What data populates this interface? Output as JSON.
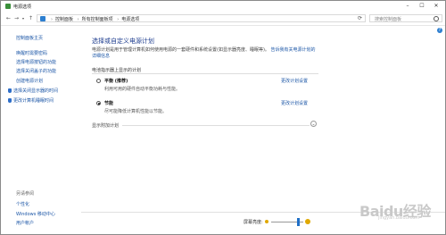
{
  "window": {
    "title": "电源选项"
  },
  "address": {
    "crumbs": [
      "控制面板",
      "所有控制面板项",
      "电源选项"
    ],
    "search_placeholder": "搜索控制面板"
  },
  "leftnav": {
    "home": "控制面板主页",
    "items": [
      "唤醒时需要密码",
      "选择电源按钮的功能",
      "选择关闭盖子的功能",
      "创建电源计划",
      "选择关闭显示器的时间",
      "更改计算机睡眠时间"
    ],
    "see_also_title": "另请参阅",
    "see_also": [
      "个性化",
      "Windows 移动中心",
      "用户帐户"
    ]
  },
  "main": {
    "heading": "选择或自定义电源计划",
    "description": "电源计划是用于管理计算机如何使用电源的一套硬件和系统设置(如显示器亮度、睡眠等)。",
    "learn_more": "告诉我有关电源计划的详细信息",
    "section_label": "电池指示器上显示的计划",
    "plans": [
      {
        "name": "平衡 (推荐)",
        "desc": "利用可用的硬件自动平衡功耗与性能。",
        "link": "更改计划设置",
        "selected": false
      },
      {
        "name": "节能",
        "desc": "尽可能降低计算机性能以节能。",
        "link": "更改计划设置",
        "selected": true
      }
    ],
    "more_plans": "显示附加计划"
  },
  "bottom": {
    "brightness_label": "屏幕亮度:",
    "brightness_value": 0.85
  },
  "watermark": {
    "text": "Baidu经验",
    "sub": "jingyan.baidu.com"
  }
}
